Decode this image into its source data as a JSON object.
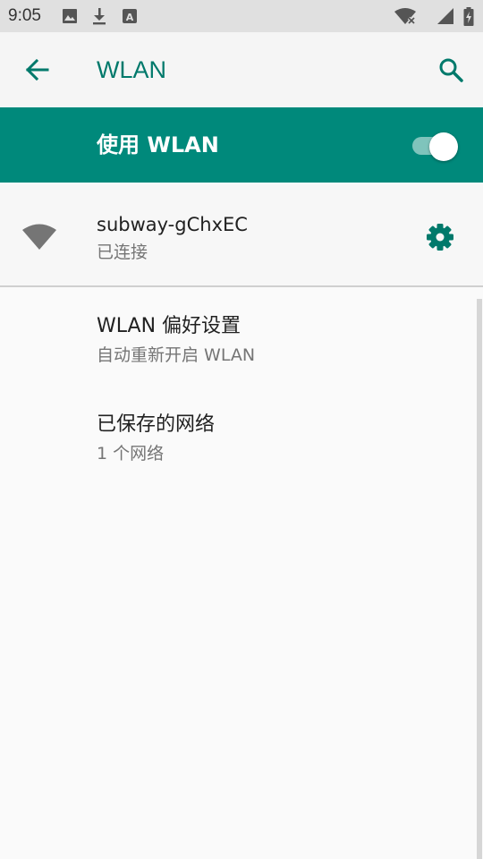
{
  "status_bar": {
    "time": "9:05",
    "icons": [
      "image-icon",
      "download-icon",
      "a-icon",
      "wifi-no-internet-icon",
      "signal-icon",
      "battery-icon"
    ]
  },
  "app_bar": {
    "title": "WLAN",
    "back_icon": "arrow-back-icon",
    "search_icon": "search-icon"
  },
  "master_switch": {
    "label": "使用 WLAN",
    "checked": true
  },
  "connected_network": {
    "name": "subway-gChxEC",
    "status": "已连接",
    "icon": "wifi-icon",
    "settings_icon": "gear-icon"
  },
  "preferences": [
    {
      "title": "WLAN 偏好设置",
      "summary": "自动重新开启 WLAN"
    },
    {
      "title": "已保存的网络",
      "summary": "1 个网络"
    }
  ],
  "colors": {
    "accent": "#00796b",
    "master_bar": "#00897b",
    "status_bar_bg": "#e0e0e0",
    "app_bar_bg": "#f5f5f5"
  }
}
